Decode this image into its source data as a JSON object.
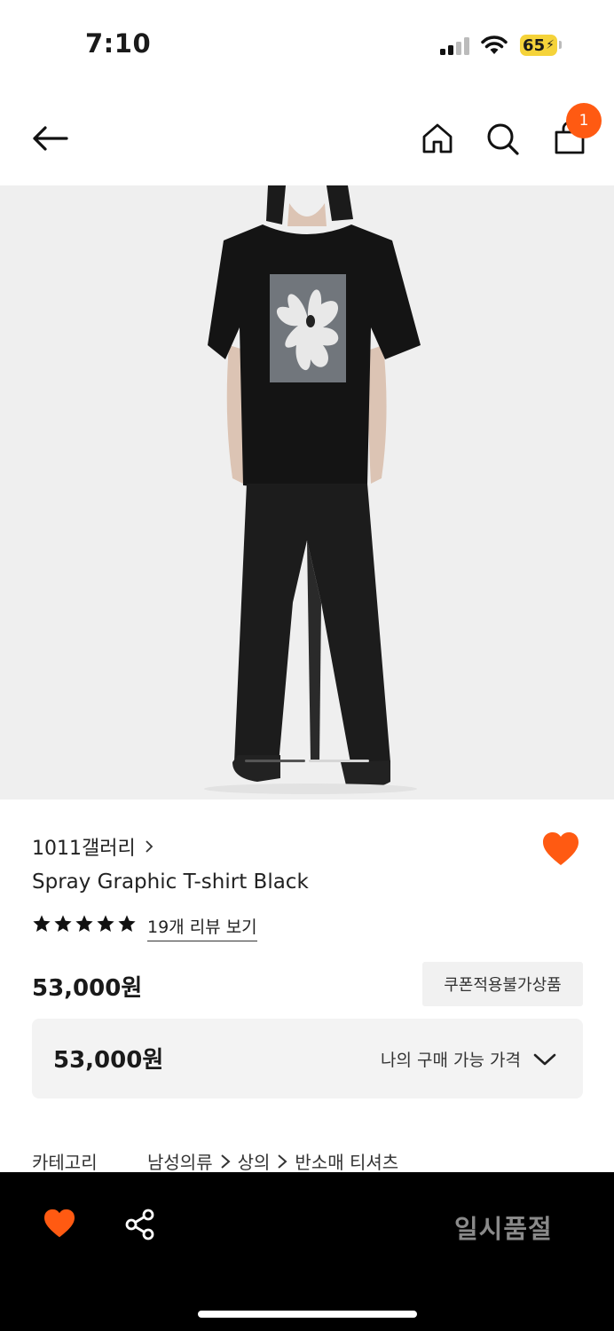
{
  "status_bar": {
    "time": "7:10",
    "battery": "65"
  },
  "header": {
    "cart_count": "1"
  },
  "product": {
    "brand": "1011갤러리",
    "title": "Spray Graphic T-shirt Black",
    "rating_stars": 5,
    "review_link": "19개 리뷰 보기",
    "price": "53,000원",
    "coupon_badge": "쿠폰적용불가상품",
    "my_price": "53,000원",
    "my_price_label": "나의 구매 가능 가격",
    "category_label": "카테고리",
    "category_path": [
      "남성의류",
      "상의",
      "반소매 티셔츠"
    ]
  },
  "bottom_bar": {
    "soldout_label": "일시품절"
  },
  "colors": {
    "accent": "#ff5a12",
    "bottom_bar": "#000000"
  }
}
